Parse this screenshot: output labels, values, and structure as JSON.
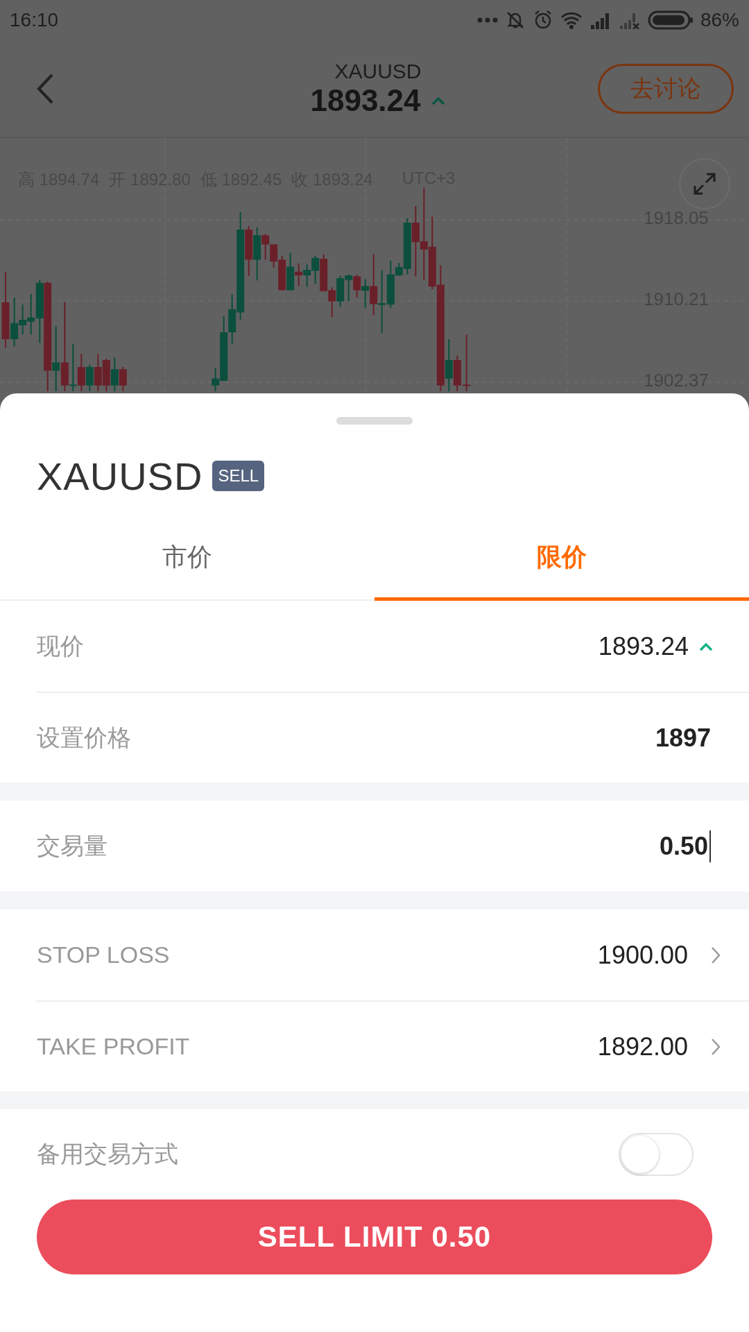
{
  "status_bar": {
    "time": "16:10",
    "battery_text": "86%"
  },
  "header": {
    "symbol": "XAUUSD",
    "price": "1893.24",
    "rising": true,
    "discuss_button": "去讨论"
  },
  "chart": {
    "ohlc": [
      {
        "label": "高",
        "value": "1894.74"
      },
      {
        "label": "开",
        "value": "1892.80"
      },
      {
        "label": "低",
        "value": "1892.45"
      },
      {
        "label": "收",
        "value": "1893.24"
      }
    ],
    "timezone": "UTC+3",
    "price_labels": [
      "1918.05",
      "1910.21",
      "1902.37"
    ]
  },
  "order": {
    "symbol": "XAUUSD",
    "side": "SELL",
    "tabs": [
      {
        "label": "市价",
        "selected": false
      },
      {
        "label": "限价",
        "selected": true
      }
    ],
    "sections": [
      {
        "rows": [
          {
            "kind": "price",
            "label": "现价",
            "value": "1893.24",
            "rising": true
          },
          {
            "kind": "input",
            "label": "设置价格",
            "value": "1897",
            "focused": false
          }
        ]
      },
      {
        "rows": [
          {
            "kind": "input",
            "label": "交易量",
            "value": "0.50",
            "focused": true
          }
        ]
      },
      {
        "rows": [
          {
            "kind": "link",
            "label": "STOP LOSS",
            "value": "1900.00"
          },
          {
            "kind": "link",
            "label": "TAKE PROFIT",
            "value": "1892.00"
          }
        ]
      }
    ],
    "toggle": {
      "label": "备用交易方式",
      "on": false
    },
    "submit_button": "SELL LIMIT 0.50"
  }
}
